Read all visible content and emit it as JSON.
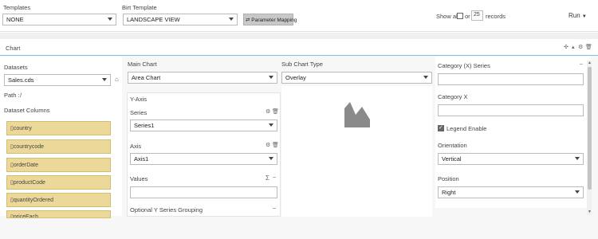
{
  "toolbar": {
    "templates_label": "Templates",
    "templates_value": "NONE",
    "birt_label": "Birt Template",
    "birt_value": "LANDSCAPE VIEW",
    "param_mapping": "Parameter Mapping",
    "show_all": "Show all",
    "or": "or",
    "records_count": "25",
    "records": "records",
    "run": "Run"
  },
  "chart_section": {
    "title": "Chart"
  },
  "datasets": {
    "label": "Datasets",
    "value": "Sales.cds",
    "path_label": "Path :",
    "path_value": "/",
    "columns_label": "Dataset Columns",
    "columns": [
      "country",
      "countrycode",
      "orderDate",
      "productCode",
      "quantityOrdered",
      "priceEach"
    ]
  },
  "main_chart": {
    "label": "Main Chart",
    "value": "Area Chart",
    "y_axis_label": "Y-Axis",
    "series_label": "Series",
    "series_value": "Series1",
    "axis_label": "Axis",
    "axis_value": "Axis1",
    "values_label": "Values",
    "optional_grouping": "Optional Y Series Grouping"
  },
  "sub_chart": {
    "label": "Sub Chart Type",
    "value": "Overlay"
  },
  "right_panel": {
    "category_series_label": "Category (X) Series",
    "category_x_label": "Category X",
    "legend_label": "Legend Enable",
    "legend_checked": true,
    "orientation_label": "Orientation",
    "orientation_value": "Vertical",
    "position_label": "Position",
    "position_value": "Right"
  },
  "colors": {
    "accent": "#7cc0e4",
    "column_bg": "#ecd99a",
    "chart_icon": "#8a8a8a"
  }
}
